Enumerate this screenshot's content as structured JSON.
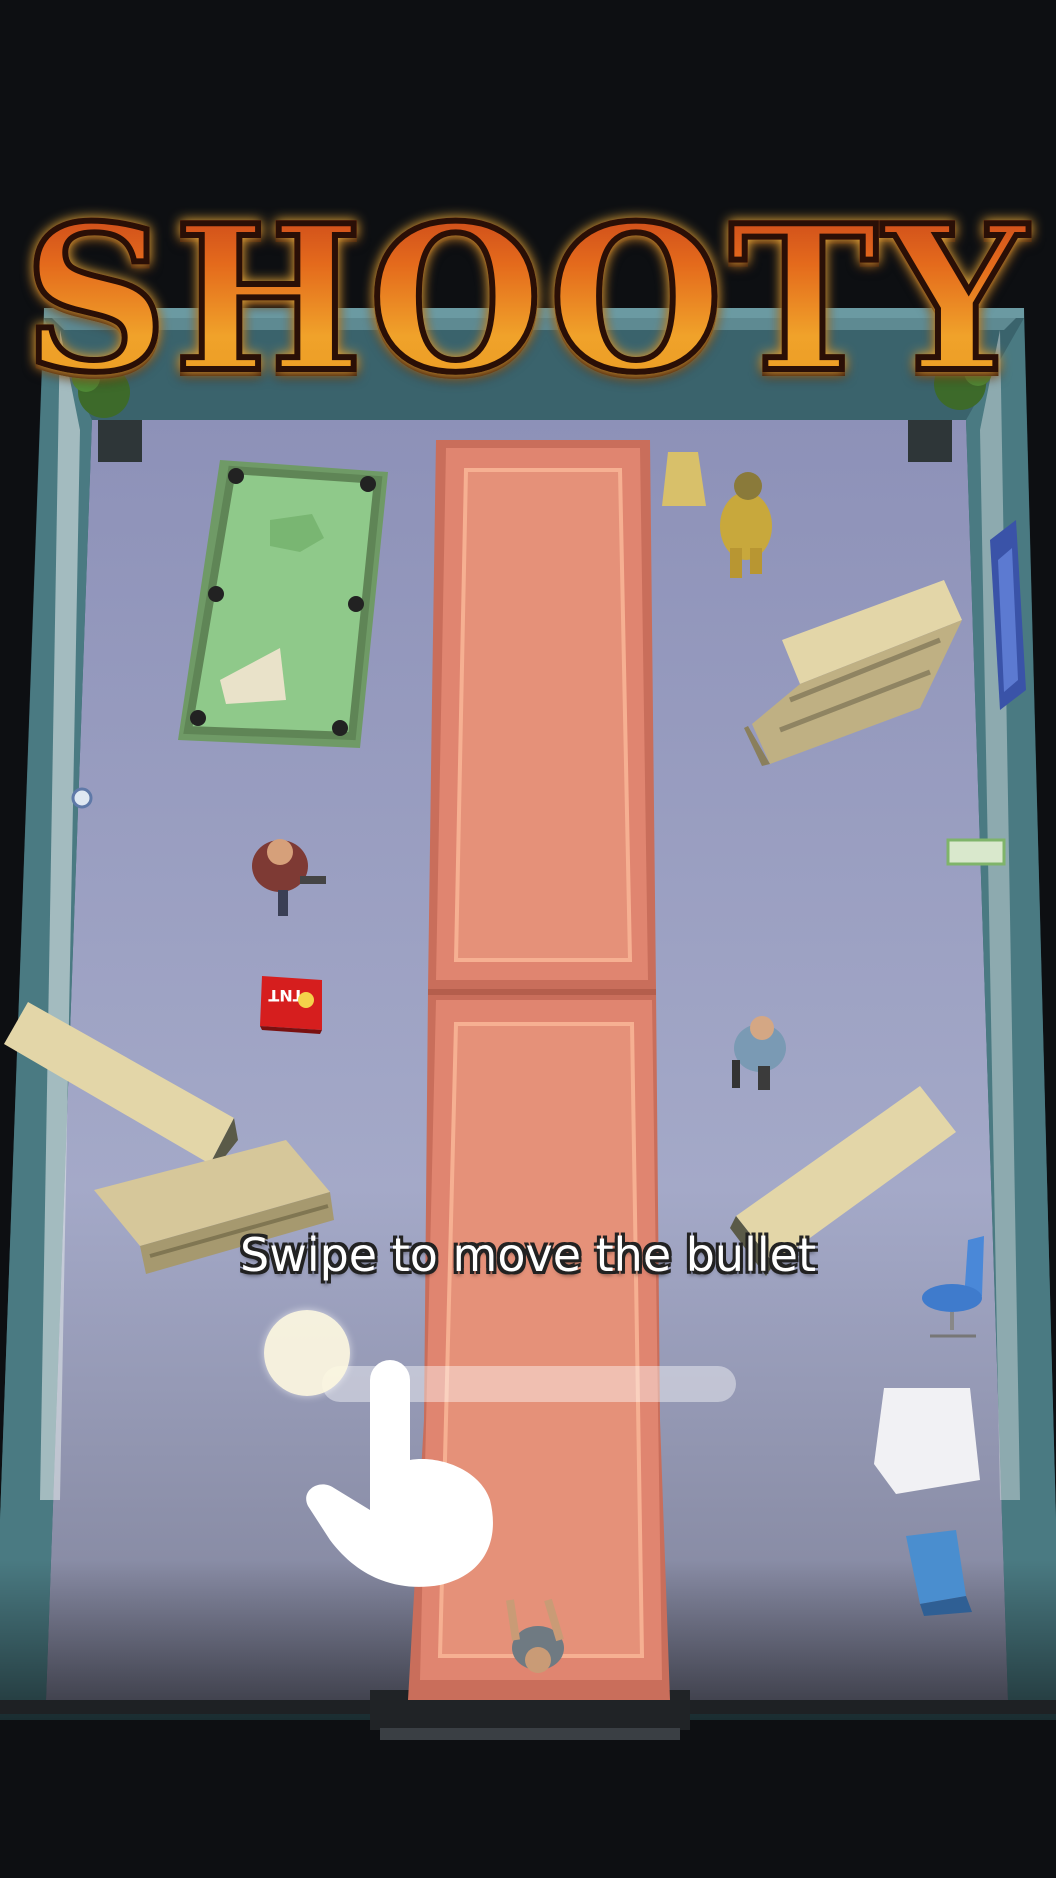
{
  "game": {
    "title": "SHOOTY",
    "hint": "Swipe to move the bullet",
    "props": {
      "tnt_label": "TNT"
    }
  },
  "colors": {
    "title_top": "#c0391a",
    "title_bottom": "#f0a22a",
    "floor": "#9ea3c2",
    "wall": "#3e6a72",
    "carpet": "#e08570",
    "pool_table": "#8fc98a",
    "furniture": "#d6c79a",
    "tnt": "#d61e1e"
  },
  "icons": [
    "hand-pointer-icon",
    "swipe-handle"
  ]
}
